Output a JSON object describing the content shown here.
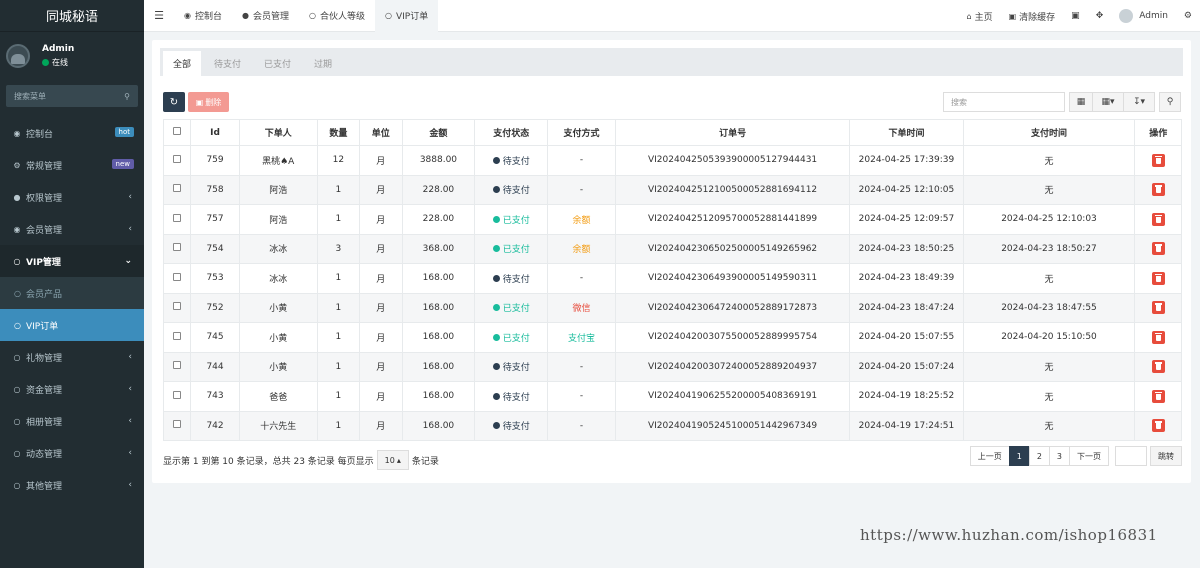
{
  "brand": "同城秘语",
  "user": {
    "name": "Admin",
    "status": "在线"
  },
  "sidebar_search": {
    "placeholder": "搜索菜单"
  },
  "menu": [
    {
      "label": "控制台",
      "icon": "dashboard-icon",
      "badge": "hot",
      "badge_color": "#3c8dbc"
    },
    {
      "label": "常规管理",
      "icon": "cogs-icon",
      "badge": "new",
      "badge_color": "#605ca8"
    },
    {
      "label": "权限管理",
      "icon": "group-icon",
      "arrow": "‹"
    },
    {
      "label": "会员管理",
      "icon": "user-circle-icon",
      "arrow": "‹"
    },
    {
      "label": "VIP管理",
      "icon": "circle-icon",
      "arrow": "⌄"
    }
  ],
  "submenu": [
    {
      "label": "会员产品"
    },
    {
      "label": "VIP订单"
    }
  ],
  "menu_bottom": [
    {
      "label": "礼物管理",
      "arrow": "‹"
    },
    {
      "label": "资金管理",
      "arrow": "‹"
    },
    {
      "label": "相册管理",
      "arrow": "‹"
    },
    {
      "label": "动态管理",
      "arrow": "‹"
    },
    {
      "label": "其他管理",
      "arrow": "‹"
    }
  ],
  "topnav": {
    "tabs": [
      {
        "label": "控制台",
        "icon": "dashboard-icon"
      },
      {
        "label": "会员管理",
        "icon": "user-icon"
      },
      {
        "label": "合伙人等级",
        "icon": "circle-icon"
      },
      {
        "label": "VIP订单",
        "icon": "circle-icon"
      }
    ],
    "home": "主页",
    "clear_cache": "清除缓存",
    "admin": "Admin"
  },
  "filter_tabs": [
    "全部",
    "待支付",
    "已支付",
    "过期"
  ],
  "toolbar": {
    "delete_label": "删除",
    "search_placeholder": "搜索"
  },
  "table": {
    "headers": [
      "Id",
      "下单人",
      "数量",
      "单位",
      "金额",
      "支付状态",
      "支付方式",
      "订单号",
      "下单时间",
      "支付时间",
      "操作"
    ],
    "rows": [
      {
        "id": "759",
        "user": "黑桃♠A",
        "qty": "12",
        "unit": "月",
        "amount": "3888.00",
        "status": "待支付",
        "status_color": "#2c3e50",
        "method": "-",
        "method_color": "#333333",
        "order_no": "VI20240425053939000051279444​31",
        "order_time": "2024-04-25 17:39:39",
        "pay_time": "无"
      },
      {
        "id": "758",
        "user": "阿浩",
        "qty": "1",
        "unit": "月",
        "amount": "228.00",
        "status": "待支付",
        "status_color": "#2c3e50",
        "method": "-",
        "method_color": "#333333",
        "order_no": "VI20240425121005000528816941​12",
        "order_time": "2024-04-25 12:10:05",
        "pay_time": "无"
      },
      {
        "id": "757",
        "user": "阿浩",
        "qty": "1",
        "unit": "月",
        "amount": "228.00",
        "status": "已支付",
        "status_color": "#18bc9c",
        "method": "余额",
        "method_color": "#f39c12",
        "order_no": "VI20240425120957000528814418​99",
        "order_time": "2024-04-25 12:09:57",
        "pay_time": "2024-04-25 12:10:03"
      },
      {
        "id": "754",
        "user": "冰冰",
        "qty": "3",
        "unit": "月",
        "amount": "368.00",
        "status": "已支付",
        "status_color": "#18bc9c",
        "method": "余额",
        "method_color": "#f39c12",
        "order_no": "VI20240423065025000051492659​62",
        "order_time": "2024-04-23 18:50:25",
        "pay_time": "2024-04-23 18:50:27"
      },
      {
        "id": "753",
        "user": "冰冰",
        "qty": "1",
        "unit": "月",
        "amount": "168.00",
        "status": "待支付",
        "status_color": "#2c3e50",
        "method": "-",
        "method_color": "#333333",
        "order_no": "VI20240423064939000051495903​11",
        "order_time": "2024-04-23 18:49:39",
        "pay_time": "无"
      },
      {
        "id": "752",
        "user": "小黄",
        "qty": "1",
        "unit": "月",
        "amount": "168.00",
        "status": "已支付",
        "status_color": "#18bc9c",
        "method": "微信",
        "method_color": "#e74c3c",
        "order_no": "VI20240423064724000528891728​73",
        "order_time": "2024-04-23 18:47:24",
        "pay_time": "2024-04-23 18:47:55"
      },
      {
        "id": "745",
        "user": "小黄",
        "qty": "1",
        "unit": "月",
        "amount": "168.00",
        "status": "已支付",
        "status_color": "#18bc9c",
        "method": "支付宝",
        "method_color": "#18bc9c",
        "order_no": "VI20240420030755000528899957​54",
        "order_time": "2024-04-20 15:07:55",
        "pay_time": "2024-04-20 15:10:50"
      },
      {
        "id": "744",
        "user": "小黄",
        "qty": "1",
        "unit": "月",
        "amount": "168.00",
        "status": "待支付",
        "status_color": "#2c3e50",
        "method": "-",
        "method_color": "#333333",
        "order_no": "VI20240420030724000528892049​37",
        "order_time": "2024-04-20 15:07:24",
        "pay_time": "无"
      },
      {
        "id": "743",
        "user": "爸爸",
        "qty": "1",
        "unit": "月",
        "amount": "168.00",
        "status": "待支付",
        "status_color": "#2c3e50",
        "method": "-",
        "method_color": "#333333",
        "order_no": "VI20240419062552000054083691​91",
        "order_time": "2024-04-19 18:25:52",
        "pay_time": "无"
      },
      {
        "id": "742",
        "user": "十六先生",
        "qty": "1",
        "unit": "月",
        "amount": "168.00",
        "status": "待支付",
        "status_color": "#2c3e50",
        "method": "-",
        "method_color": "#333333",
        "order_no": "VI20240419052451000514429673​49",
        "order_time": "2024-04-19 17:24:51",
        "pay_time": "无"
      }
    ]
  },
  "pager": {
    "info_before": "显示第 1 到第 10 条记录，总共 23 条记录 每页显示",
    "page_size": "10",
    "info_after": "条记录",
    "prev": "上一页",
    "pages": [
      "1",
      "2",
      "3"
    ],
    "next": "下一页",
    "jump": "跳转"
  },
  "watermark": "https://www.huzhan.com/ishop16831"
}
